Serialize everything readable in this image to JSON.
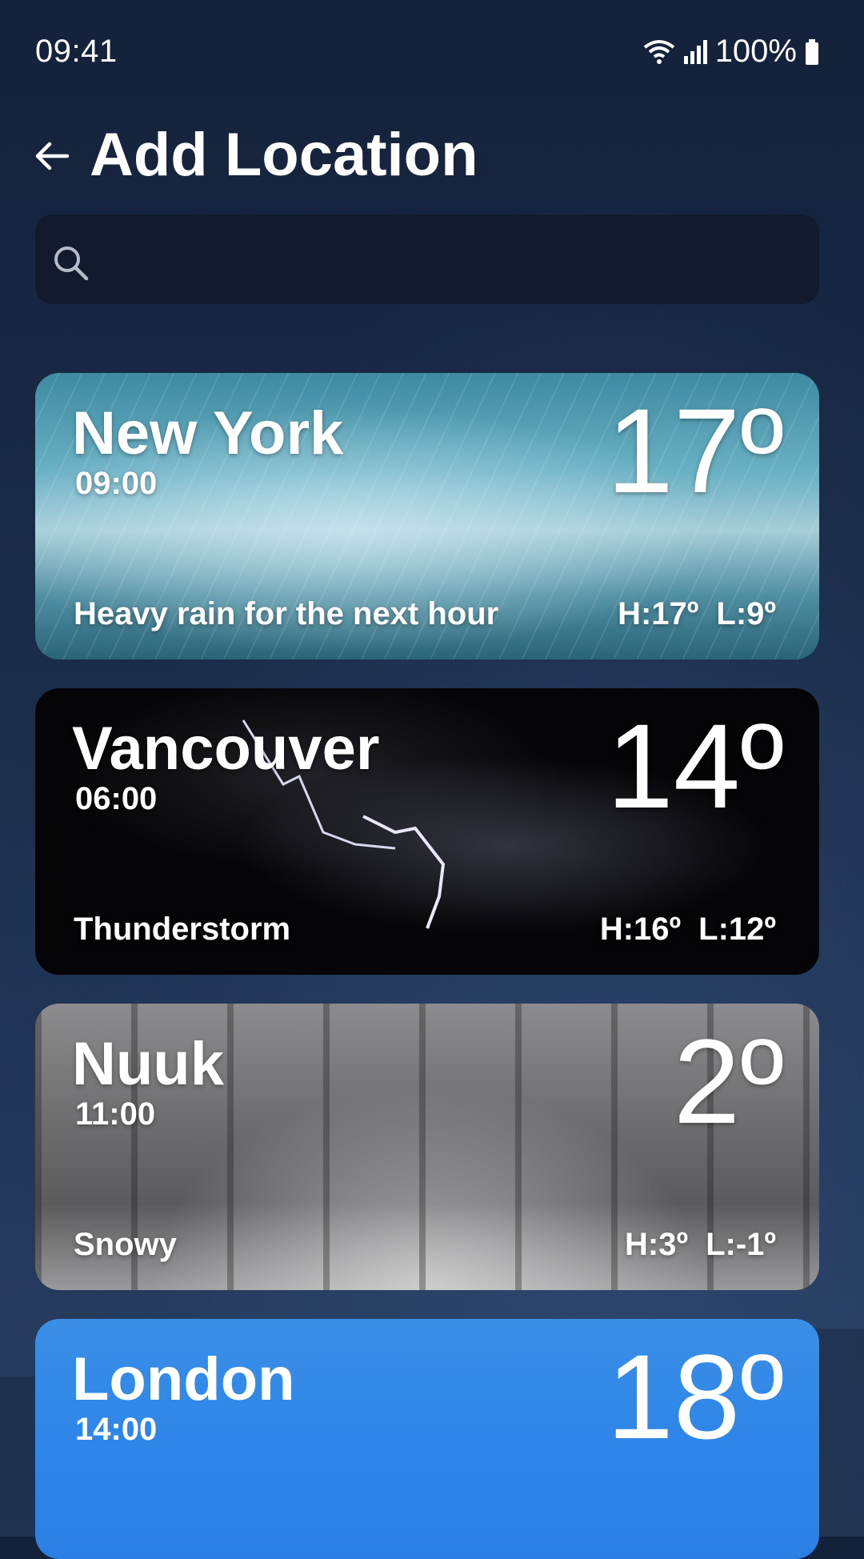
{
  "status_bar": {
    "time": "09:41",
    "battery": "100%",
    "icons": [
      "wifi-icon",
      "signal-icon",
      "battery-icon"
    ]
  },
  "header": {
    "title": "Add Location",
    "back_icon": "arrow-left-icon"
  },
  "search": {
    "placeholder": "",
    "value": "",
    "icon": "search-icon"
  },
  "locations": [
    {
      "city": "New York",
      "time": "09:00",
      "temp": "17º",
      "condition": "Heavy rain for the next hour",
      "high": "H:17º",
      "low": "L:9º"
    },
    {
      "city": "Vancouver",
      "time": "06:00",
      "temp": "14º",
      "condition": "Thunderstorm",
      "high": "H:16º",
      "low": "L:12º"
    },
    {
      "city": "Nuuk",
      "time": "11:00",
      "temp": "2º",
      "condition": "Snowy",
      "high": "H:3º",
      "low": "L:-1º"
    },
    {
      "city": "London",
      "time": "14:00",
      "temp": "18º"
    }
  ],
  "colors": {
    "background": "#1b2d4a",
    "search_bg": "#111b2d",
    "london_card": "#2f86e8"
  }
}
